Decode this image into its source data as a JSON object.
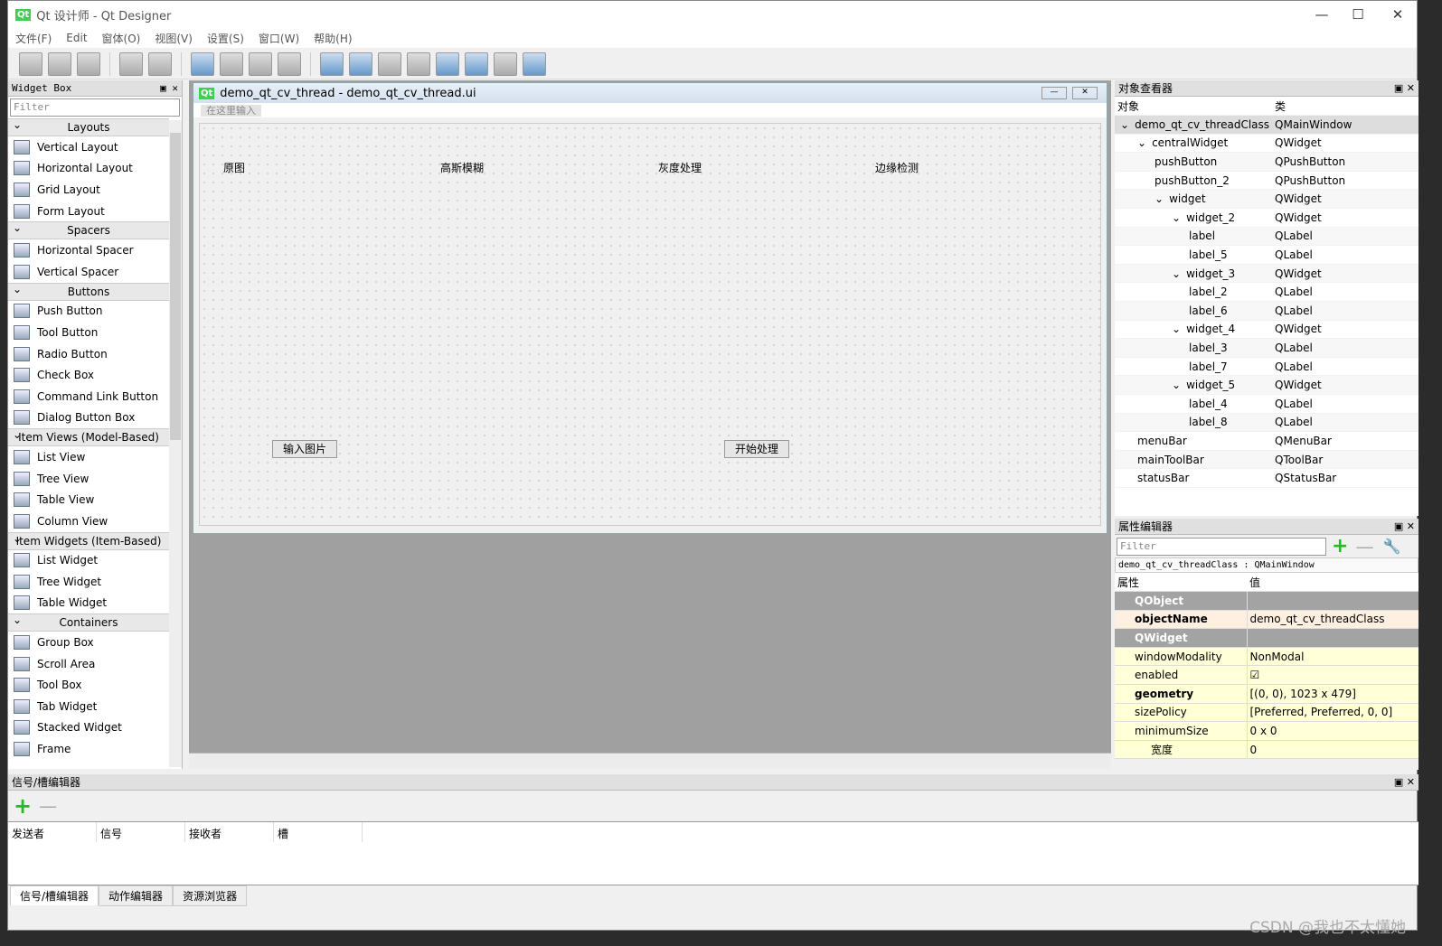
{
  "window": {
    "title": "Qt 设计师 - Qt Designer"
  },
  "menu": [
    "文件(F)",
    "Edit",
    "窗体(O)",
    "视图(V)",
    "设置(S)",
    "窗口(W)",
    "帮助(H)"
  ],
  "widget_box": {
    "title": "Widget Box",
    "filter": "Filter",
    "categories": [
      {
        "name": "Layouts",
        "items": [
          "Vertical Layout",
          "Horizontal Layout",
          "Grid Layout",
          "Form Layout"
        ]
      },
      {
        "name": "Spacers",
        "items": [
          "Horizontal Spacer",
          "Vertical Spacer"
        ]
      },
      {
        "name": "Buttons",
        "items": [
          "Push Button",
          "Tool Button",
          "Radio Button",
          "Check Box",
          "Command Link Button",
          "Dialog Button Box"
        ]
      },
      {
        "name": "Item Views (Model-Based)",
        "items": [
          "List View",
          "Tree View",
          "Table View",
          "Column View"
        ]
      },
      {
        "name": "Item Widgets (Item-Based)",
        "items": [
          "List Widget",
          "Tree Widget",
          "Table Widget"
        ]
      },
      {
        "name": "Containers",
        "items": [
          "Group Box",
          "Scroll Area",
          "Tool Box",
          "Tab Widget",
          "Stacked Widget",
          "Frame"
        ]
      }
    ]
  },
  "form": {
    "title": "demo_qt_cv_thread - demo_qt_cv_thread.ui",
    "menu_placeholder": "在这里输入",
    "labels": [
      "原图",
      "高斯模糊",
      "灰度处理",
      "边缘检测"
    ],
    "buttons": [
      "输入图片",
      "开始处理"
    ]
  },
  "object_inspector": {
    "title": "对象查看器",
    "headers": [
      "对象",
      "类"
    ],
    "rows": [
      {
        "name": "demo_qt_cv_threadClass",
        "cls": "QMainWindow",
        "level": 0
      },
      {
        "name": "centralWidget",
        "cls": "QWidget",
        "level": 1
      },
      {
        "name": "pushButton",
        "cls": "QPushButton",
        "level": 2
      },
      {
        "name": "pushButton_2",
        "cls": "QPushButton",
        "level": 2
      },
      {
        "name": "widget",
        "cls": "QWidget",
        "level": 2
      },
      {
        "name": "widget_2",
        "cls": "QWidget",
        "level": 3
      },
      {
        "name": "label",
        "cls": "QLabel",
        "level": 4
      },
      {
        "name": "label_5",
        "cls": "QLabel",
        "level": 4
      },
      {
        "name": "widget_3",
        "cls": "QWidget",
        "level": 3
      },
      {
        "name": "label_2",
        "cls": "QLabel",
        "level": 4
      },
      {
        "name": "label_6",
        "cls": "QLabel",
        "level": 4
      },
      {
        "name": "widget_4",
        "cls": "QWidget",
        "level": 3
      },
      {
        "name": "label_3",
        "cls": "QLabel",
        "level": 4
      },
      {
        "name": "label_7",
        "cls": "QLabel",
        "level": 4
      },
      {
        "name": "widget_5",
        "cls": "QWidget",
        "level": 3
      },
      {
        "name": "label_4",
        "cls": "QLabel",
        "level": 4
      },
      {
        "name": "label_8",
        "cls": "QLabel",
        "level": 4
      },
      {
        "name": "menuBar",
        "cls": "QMenuBar",
        "level": 1
      },
      {
        "name": "mainToolBar",
        "cls": "QToolBar",
        "level": 1
      },
      {
        "name": "statusBar",
        "cls": "QStatusBar",
        "level": 1
      }
    ]
  },
  "property_editor": {
    "title": "属性编辑器",
    "filter": "Filter",
    "context": "demo_qt_cv_threadClass : QMainWindow",
    "headers": [
      "属性",
      "值"
    ],
    "rows": [
      {
        "k": "QObject",
        "v": "",
        "type": "group"
      },
      {
        "k": "objectName",
        "v": "demo_qt_cv_threadClass",
        "type": "o"
      },
      {
        "k": "QWidget",
        "v": "",
        "type": "group"
      },
      {
        "k": "windowModality",
        "v": "NonModal",
        "type": "y"
      },
      {
        "k": "enabled",
        "v": "☑",
        "type": "y"
      },
      {
        "k": "geometry",
        "v": "[(0, 0), 1023 x 479]",
        "type": "y"
      },
      {
        "k": "sizePolicy",
        "v": "[Preferred, Preferred, 0, 0]",
        "type": "y"
      },
      {
        "k": "minimumSize",
        "v": "0 x 0",
        "type": "y"
      },
      {
        "k": "宽度",
        "v": "0",
        "type": "y"
      }
    ]
  },
  "signal_editor": {
    "title": "信号/槽编辑器",
    "headers": [
      "发送者",
      "信号",
      "接收者",
      "槽"
    ],
    "tabs": [
      "信号/槽编辑器",
      "动作编辑器",
      "资源浏览器"
    ]
  },
  "watermark": "CSDN @我也不太懂她"
}
